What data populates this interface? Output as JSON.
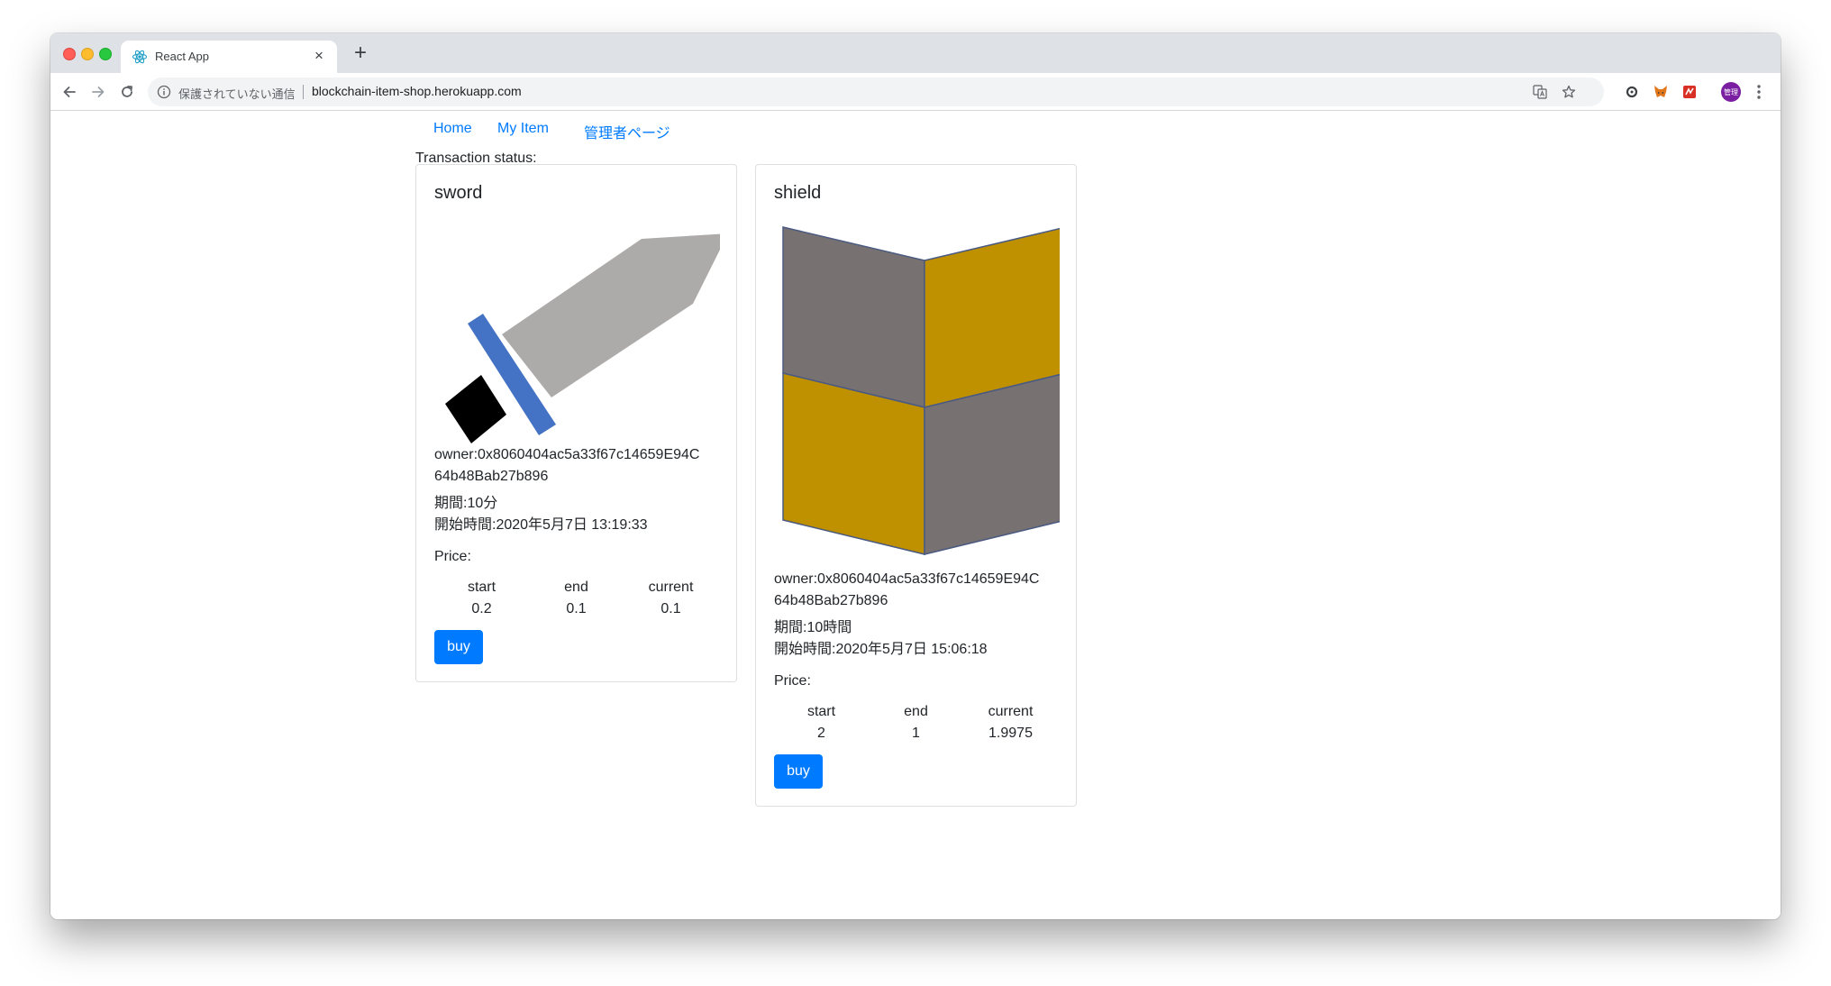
{
  "browser": {
    "tab_title": "React App",
    "tab_close": "×",
    "new_tab": "+",
    "security_label": "保護されていない通信",
    "url": "blockchain-item-shop.herokuapp.com",
    "profile_initials": "管理"
  },
  "nav": {
    "home": "Home",
    "my_item": "My Item",
    "admin": "管理者ページ"
  },
  "transaction_status_label": "Transaction status:",
  "price_headers": {
    "start": "start",
    "end": "end",
    "current": "current"
  },
  "items": [
    {
      "name": "sword",
      "owner_line1": "owner:0x8060404ac5a33f67c14659E94C",
      "owner_line2": "64b48Bab27b896",
      "period": "期間:10分",
      "start_time": "開始時間:2020年5月7日 13:19:33",
      "price_label": "Price:",
      "price_start": "0.2",
      "price_end": "0.1",
      "price_current": "0.1",
      "buy_label": "buy"
    },
    {
      "name": "shield",
      "owner_line1": "owner:0x8060404ac5a33f67c14659E94C",
      "owner_line2": "64b48Bab27b896",
      "period": "期間:10時間",
      "start_time": "開始時間:2020年5月7日 15:06:18",
      "price_label": "Price:",
      "price_start": "2",
      "price_end": "1",
      "price_current": "1.9975",
      "buy_label": "buy"
    }
  ],
  "colors": {
    "link": "#007bff",
    "button": "#007bff",
    "sword_blade": "#adaaaa",
    "sword_guard": "#4472c4",
    "shield_gray": "#777171",
    "shield_gold": "#bf9000"
  }
}
